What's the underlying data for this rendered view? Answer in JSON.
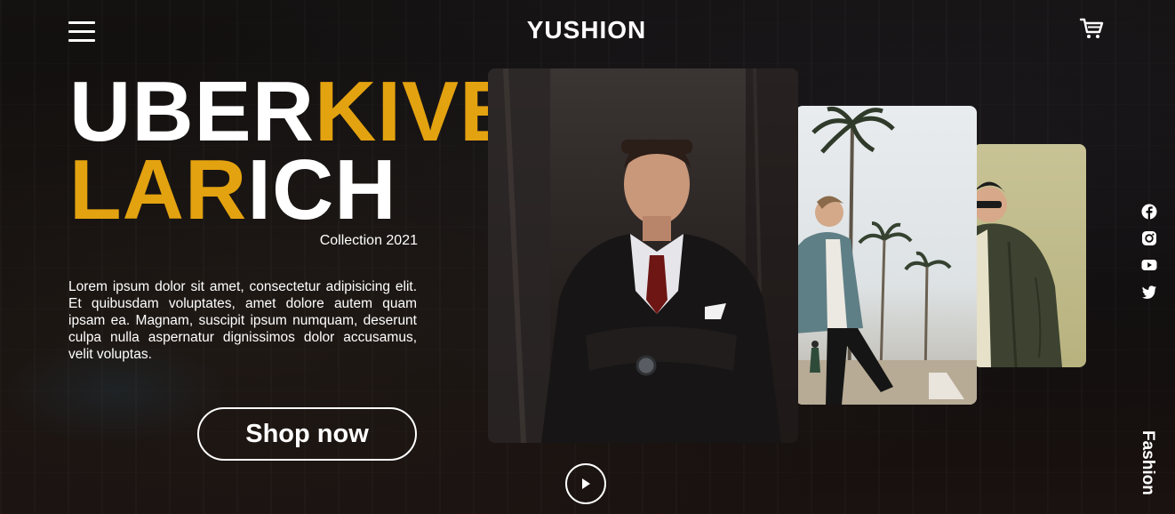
{
  "header": {
    "brand": "YUSHION",
    "menu_icon": "hamburger-menu-icon",
    "cart_icon": "shopping-cart-icon"
  },
  "hero": {
    "headline_line1_white": "UBER",
    "headline_line1_yellow": "KIVE",
    "headline_line2_yellow": "LAR",
    "headline_line2_white": "ICH",
    "collection": "Collection 2021",
    "description": "Lorem ipsum dolor sit amet, consectetur adipisicing elit. Et quibusdam voluptates, amet dolore autem quam ipsam ea. Magnam, suscipit ipsum numquam, deserunt culpa nulla aspernatur dignissimos dolor accusamus, velit voluptas.",
    "cta_label": "Shop now"
  },
  "gallery": {
    "photos": [
      "man-in-suit-photo",
      "man-with-palm-trees-photo",
      "man-in-green-jacket-photo"
    ],
    "play_icon": "play-icon"
  },
  "social": {
    "icons": [
      "facebook-icon",
      "instagram-icon",
      "youtube-icon",
      "twitter-icon"
    ]
  },
  "side_label": "Fashion",
  "colors": {
    "accent": "#e3a20f",
    "text": "#ffffff",
    "background": "#0c0a09"
  }
}
